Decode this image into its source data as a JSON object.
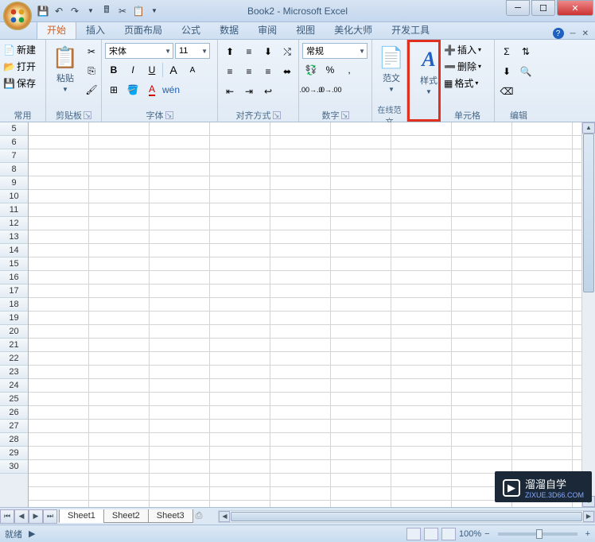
{
  "title": "Book2 - Microsoft Excel",
  "tabs": {
    "home": "开始",
    "insert": "插入",
    "layout": "页面布局",
    "formulas": "公式",
    "data": "数据",
    "review": "审阅",
    "view": "视图",
    "beautify": "美化大师",
    "developer": "开发工具"
  },
  "groups": {
    "common": "常用",
    "clipboard": "剪贴板",
    "font": "字体",
    "alignment": "对齐方式",
    "number": "数字",
    "online": "在线范文",
    "styles_btn": "样式",
    "quick_btn": "范文",
    "cells": "单元格",
    "editing": "编辑"
  },
  "buttons": {
    "new": "新建",
    "open": "打开",
    "save": "保存",
    "paste": "粘贴",
    "insert_cell": "插入",
    "delete_cell": "删除",
    "format_cell": "格式"
  },
  "font": {
    "name": "宋体",
    "size": "11"
  },
  "number_format": "常规",
  "row_headers": [
    5,
    6,
    7,
    8,
    9,
    10,
    11,
    12,
    13,
    14,
    15,
    16,
    17,
    18,
    19,
    20,
    21,
    22,
    23,
    24,
    25,
    26,
    27,
    28,
    29,
    30
  ],
  "sheets": {
    "nav": [
      "⏮",
      "◀",
      "▶",
      "⏭"
    ],
    "tabs": [
      "Sheet1",
      "Sheet2",
      "Sheet3"
    ]
  },
  "status": {
    "ready": "就绪",
    "zoom": "100%"
  },
  "watermark": {
    "text": "溜溜自学",
    "sub": "ZIXUE.3D66.COM"
  }
}
